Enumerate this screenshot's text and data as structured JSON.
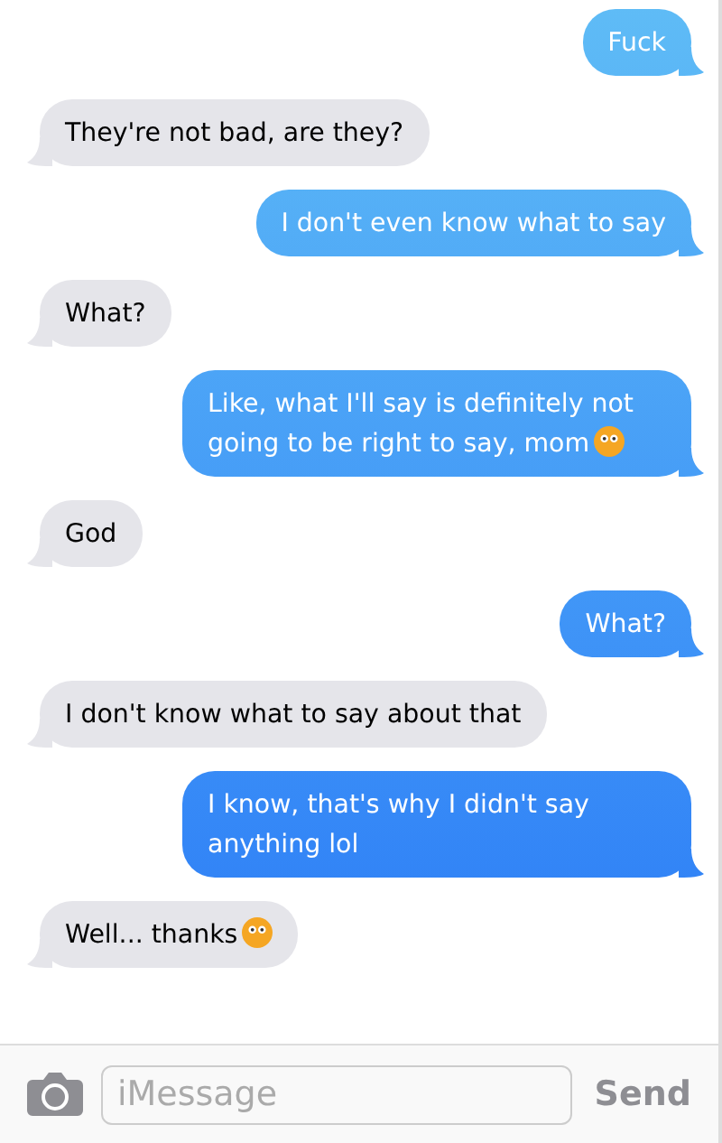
{
  "messages": [
    {
      "text": "Fuck",
      "kind": "sent",
      "emoji": false
    },
    {
      "text": "They're not bad, are they?",
      "kind": "received",
      "emoji": false
    },
    {
      "text": "I don't even know what to say",
      "kind": "sent",
      "emoji": false
    },
    {
      "text": "What?",
      "kind": "received",
      "emoji": false
    },
    {
      "text": "Like, what I'll say is definitely not going to be right to say, mom",
      "kind": "sent",
      "emoji": true
    },
    {
      "text": "God",
      "kind": "received",
      "emoji": false
    },
    {
      "text": "What?",
      "kind": "sent",
      "emoji": false
    },
    {
      "text": "I don't know what to say about that",
      "kind": "received",
      "emoji": false
    },
    {
      "text": "I know, that's why I didn't say anything lol",
      "kind": "sent",
      "emoji": false
    },
    {
      "text": "Well... thanks",
      "kind": "received",
      "emoji": true
    }
  ],
  "composer": {
    "placeholder": "iMessage",
    "send_label": "Send"
  }
}
